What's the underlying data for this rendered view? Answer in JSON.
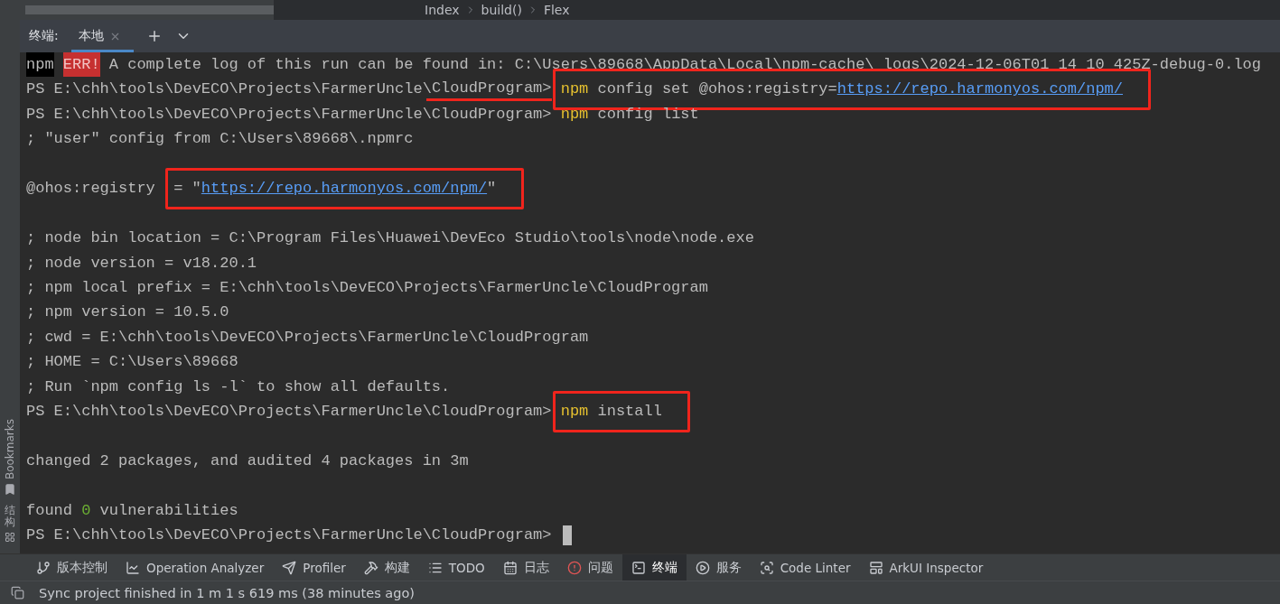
{
  "breadcrumb": [
    "Index",
    "build()",
    "Flex"
  ],
  "side_panel": [
    {
      "label": "Bookmarks",
      "kind": "latin"
    },
    {
      "label": "结构",
      "kind": "cjk"
    }
  ],
  "terminal": {
    "label": "终端:",
    "tabs": [
      {
        "label": "本地",
        "selected": true
      }
    ],
    "lines": [
      {
        "kind": "text",
        "items": [
          {
            "text": "npm",
            "kind": "npm-badge"
          },
          {
            "text": "ERR!",
            "kind": "err-badge"
          },
          {
            "text": " A complete log of this run can be found in: C:\\Users\\89668\\AppData\\Local\\npm-cache\\ logs\\2024-12-06T01 14 10 425Z-debug-0.log",
            "kind": "plain"
          }
        ]
      },
      {
        "kind": "text",
        "items": [
          {
            "text": "PS E:\\chh\\tools\\DevECO\\Projects\\FarmerUncle\\",
            "kind": "plain"
          },
          {
            "kind": "underline",
            "items": [
              {
                "text": "CloudProgram>",
                "kind": "plain"
              }
            ]
          },
          {
            "kind": "box",
            "items": [
              {
                "text": "npm",
                "kind": "command"
              },
              {
                "text": " config set @ohos:registry=",
                "kind": "plain"
              },
              {
                "text": "https://repo.harmonyos.com/npm/",
                "kind": "link"
              }
            ]
          }
        ]
      },
      {
        "kind": "text",
        "items": [
          {
            "text": "PS E:\\chh\\tools\\DevECO\\Projects\\FarmerUncle\\CloudProgram> ",
            "kind": "plain"
          },
          {
            "text": "npm",
            "kind": "command"
          },
          {
            "text": " config list",
            "kind": "plain"
          }
        ]
      },
      {
        "kind": "text",
        "items": [
          {
            "text": "; \"user\" config from C:\\Users\\89668\\.npmrc",
            "kind": "plain"
          }
        ]
      },
      {
        "kind": "blank"
      },
      {
        "kind": "text",
        "items": [
          {
            "text": "@ohos:registry ",
            "kind": "plain"
          },
          {
            "kind": "box",
            "items": [
              {
                "text": "= \"",
                "kind": "plain"
              },
              {
                "text": "https://repo.harmonyos.com/npm/",
                "kind": "link"
              },
              {
                "text": "\"",
                "kind": "plain"
              }
            ]
          }
        ]
      },
      {
        "kind": "blank"
      },
      {
        "kind": "text",
        "items": [
          {
            "text": "; node bin location = C:\\Program Files\\Huawei\\DevEco Studio\\tools\\node\\node.exe",
            "kind": "plain"
          }
        ]
      },
      {
        "kind": "text",
        "items": [
          {
            "text": "; node version = v18.20.1",
            "kind": "plain"
          }
        ]
      },
      {
        "kind": "text",
        "items": [
          {
            "text": "; npm local prefix = E:\\chh\\tools\\DevECO\\Projects\\FarmerUncle\\CloudProgram",
            "kind": "plain"
          }
        ]
      },
      {
        "kind": "text",
        "items": [
          {
            "text": "; npm version = 10.5.0",
            "kind": "plain"
          }
        ]
      },
      {
        "kind": "text",
        "items": [
          {
            "text": "; cwd = E:\\chh\\tools\\DevECO\\Projects\\FarmerUncle\\CloudProgram",
            "kind": "plain"
          }
        ]
      },
      {
        "kind": "text",
        "items": [
          {
            "text": "; HOME = C:\\Users\\89668",
            "kind": "plain"
          }
        ]
      },
      {
        "kind": "text",
        "items": [
          {
            "text": "; Run `npm config ls -l` to show all defaults.",
            "kind": "plain"
          }
        ]
      },
      {
        "kind": "text",
        "items": [
          {
            "text": "PS E:\\chh\\tools\\DevECO\\Projects\\FarmerUncle\\CloudProgram>",
            "kind": "plain"
          },
          {
            "kind": "box",
            "items": [
              {
                "text": "npm",
                "kind": "command"
              },
              {
                "text": " install",
                "kind": "plain"
              }
            ]
          }
        ]
      },
      {
        "kind": "blank"
      },
      {
        "kind": "text",
        "items": [
          {
            "text": "changed 2 packages, and audited 4 packages in 3m",
            "kind": "plain"
          }
        ]
      },
      {
        "kind": "blank"
      },
      {
        "kind": "text",
        "items": [
          {
            "text": "found ",
            "kind": "plain"
          },
          {
            "text": "0",
            "kind": "number"
          },
          {
            "text": " vulnerabilities",
            "kind": "plain"
          }
        ]
      },
      {
        "kind": "prompt",
        "items": [
          {
            "text": "PS E:\\chh\\tools\\DevECO\\Projects\\FarmerUncle\\CloudProgram> ",
            "kind": "plain"
          }
        ]
      }
    ]
  },
  "tool_windows": [
    {
      "label": "版本控制",
      "selected": false
    },
    {
      "label": "Operation Analyzer",
      "selected": false
    },
    {
      "label": "Profiler",
      "selected": false
    },
    {
      "label": "构建",
      "selected": false
    },
    {
      "label": "TODO",
      "selected": false
    },
    {
      "label": "日志",
      "selected": false
    },
    {
      "label": "问题",
      "selected": false
    },
    {
      "label": "终端",
      "selected": true
    },
    {
      "label": "服务",
      "selected": false
    },
    {
      "label": "Code Linter",
      "selected": false
    },
    {
      "label": "ArkUI Inspector",
      "selected": false
    }
  ],
  "status_bar": {
    "message": "Sync project finished in 1 m 1 s 619 ms (38 minutes ago)"
  }
}
